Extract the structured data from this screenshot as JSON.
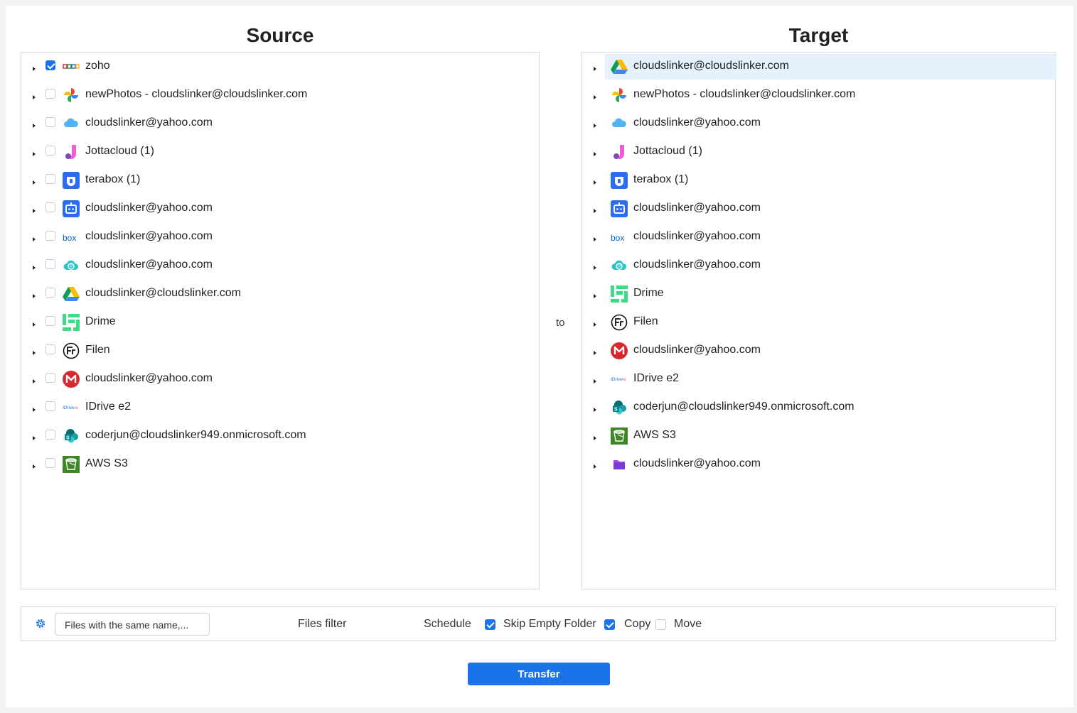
{
  "source": {
    "title": "Source",
    "items": [
      {
        "label": "zoho",
        "icon": "zoho-icon",
        "checked": true
      },
      {
        "label": "newPhotos - cloudslinker@cloudslinker.com",
        "icon": "google-photos-icon",
        "checked": false
      },
      {
        "label": "cloudslinker@yahoo.com",
        "icon": "icloud-icon",
        "checked": false
      },
      {
        "label": "Jottacloud (1)",
        "icon": "jottacloud-icon",
        "checked": false
      },
      {
        "label": "terabox (1)",
        "icon": "terabox-icon",
        "checked": false
      },
      {
        "label": "cloudslinker@yahoo.com",
        "icon": "pcloud-bot-icon",
        "checked": false
      },
      {
        "label": "cloudslinker@yahoo.com",
        "icon": "box-icon",
        "checked": false
      },
      {
        "label": "cloudslinker@yahoo.com",
        "icon": "pikpak-icon",
        "checked": false
      },
      {
        "label": "cloudslinker@cloudslinker.com",
        "icon": "google-drive-icon",
        "checked": false
      },
      {
        "label": "Drime",
        "icon": "drime-icon",
        "checked": false
      },
      {
        "label": "Filen",
        "icon": "filen-icon",
        "checked": false
      },
      {
        "label": "cloudslinker@yahoo.com",
        "icon": "mega-icon",
        "checked": false
      },
      {
        "label": "IDrive e2",
        "icon": "idrive-icon",
        "checked": false
      },
      {
        "label": "coderjun@cloudslinker949.onmicrosoft.com",
        "icon": "sharepoint-icon",
        "checked": false
      },
      {
        "label": "AWS S3",
        "icon": "aws-s3-icon",
        "checked": false
      }
    ]
  },
  "to_label": "to",
  "target": {
    "title": "Target",
    "items": [
      {
        "label": "cloudslinker@cloudslinker.com",
        "icon": "google-drive-icon",
        "selected": true
      },
      {
        "label": "newPhotos - cloudslinker@cloudslinker.com",
        "icon": "google-photos-icon"
      },
      {
        "label": "cloudslinker@yahoo.com",
        "icon": "icloud-icon"
      },
      {
        "label": "Jottacloud (1)",
        "icon": "jottacloud-icon"
      },
      {
        "label": "terabox (1)",
        "icon": "terabox-icon"
      },
      {
        "label": "cloudslinker@yahoo.com",
        "icon": "pcloud-bot-icon"
      },
      {
        "label": "cloudslinker@yahoo.com",
        "icon": "box-icon"
      },
      {
        "label": "cloudslinker@yahoo.com",
        "icon": "pikpak-icon"
      },
      {
        "label": "Drime",
        "icon": "drime-icon"
      },
      {
        "label": "Filen",
        "icon": "filen-icon"
      },
      {
        "label": "cloudslinker@yahoo.com",
        "icon": "mega-icon"
      },
      {
        "label": "IDrive e2",
        "icon": "idrive-icon"
      },
      {
        "label": "coderjun@cloudslinker949.onmicrosoft.com",
        "icon": "sharepoint-icon"
      },
      {
        "label": "AWS S3",
        "icon": "aws-s3-icon"
      },
      {
        "label": "cloudslinker@yahoo.com",
        "icon": "purple-folder-icon"
      }
    ]
  },
  "options": {
    "same_name_select": "Files with the same name,...",
    "files_filter": "Files filter",
    "schedule": "Schedule",
    "skip_empty_folder": "Skip Empty Folder",
    "skip_empty_folder_checked": true,
    "copy": "Copy",
    "copy_checked": true,
    "move": "Move",
    "move_checked": false
  },
  "transfer_button": "Transfer",
  "colors": {
    "accent": "#1a73e8",
    "selected_row": "#e5f1fd"
  }
}
